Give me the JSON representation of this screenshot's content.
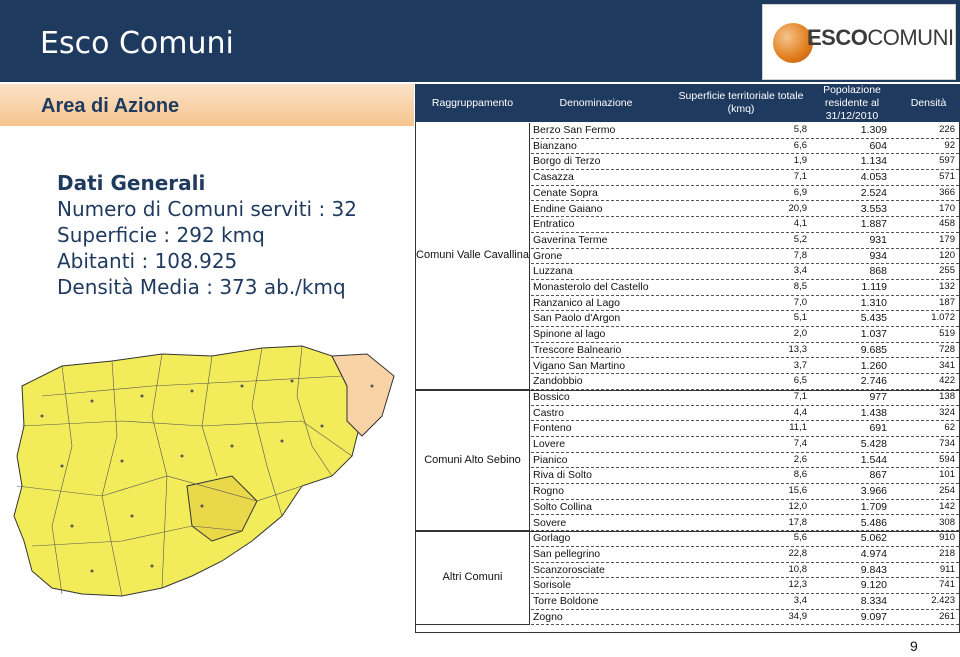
{
  "header": {
    "title": "Esco Comuni"
  },
  "logo": {
    "text_bold": "ESCO",
    "text_thin": "COMUNI"
  },
  "left": {
    "area_title": "Area di Azione",
    "dati_heading": "Dati Generali",
    "dati_lines": [
      "Numero di Comuni serviti : 32",
      "Superficie : 292 kmq",
      "Abitanti : 108.925",
      "Densità Media : 373 ab./kmq"
    ]
  },
  "table": {
    "headers": {
      "raggruppamento": "Raggruppamento",
      "denominazione": "Denominazione",
      "superficie": "Superficie territoriale totale (kmq)",
      "popolazione": "Popolazione residente al 31/12/2010",
      "densita": "Densità"
    },
    "groups": [
      {
        "label": "Comuni Valle Cavallina",
        "rows": [
          [
            "Berzo San Fermo",
            "5,8",
            "1.309",
            "226"
          ],
          [
            "Bianzano",
            "6,6",
            "604",
            "92"
          ],
          [
            "Borgo di Terzo",
            "1,9",
            "1.134",
            "597"
          ],
          [
            "Casazza",
            "7,1",
            "4.053",
            "571"
          ],
          [
            "Cenate Sopra",
            "6,9",
            "2.524",
            "366"
          ],
          [
            "Endine Gaiano",
            "20,9",
            "3.553",
            "170"
          ],
          [
            "Entratico",
            "4,1",
            "1.887",
            "458"
          ],
          [
            "Gaverina Terme",
            "5,2",
            "931",
            "179"
          ],
          [
            "Grone",
            "7,8",
            "934",
            "120"
          ],
          [
            "Luzzana",
            "3,4",
            "868",
            "255"
          ],
          [
            "Monasterolo del Castello",
            "8,5",
            "1.119",
            "132"
          ],
          [
            "Ranzanico al Lago",
            "7,0",
            "1.310",
            "187"
          ],
          [
            "San Paolo d'Argon",
            "5,1",
            "5.435",
            "1.072"
          ],
          [
            "Spinone al lago",
            "2,0",
            "1.037",
            "519"
          ],
          [
            "Trescore Balneario",
            "13,3",
            "9.685",
            "728"
          ],
          [
            "Vigano San Martino",
            "3,7",
            "1.260",
            "341"
          ],
          [
            "Zandobbio",
            "6,5",
            "2.746",
            "422"
          ]
        ]
      },
      {
        "label": "Comuni Alto Sebino",
        "rows": [
          [
            "Bossico",
            "7,1",
            "977",
            "138"
          ],
          [
            "Castro",
            "4,4",
            "1.438",
            "324"
          ],
          [
            "Fonteno",
            "11,1",
            "691",
            "62"
          ],
          [
            "Lovere",
            "7,4",
            "5.428",
            "734"
          ],
          [
            "Pianico",
            "2,6",
            "1.544",
            "594"
          ],
          [
            "Riva di Solto",
            "8,6",
            "867",
            "101"
          ],
          [
            "Rogno",
            "15,6",
            "3.966",
            "254"
          ],
          [
            "Solto Collina",
            "12,0",
            "1.709",
            "142"
          ],
          [
            "Sovere",
            "17,8",
            "5.486",
            "308"
          ]
        ]
      },
      {
        "label": "Altri Comuni",
        "rows": [
          [
            "Gorlago",
            "5,6",
            "5.062",
            "910"
          ],
          [
            "San pellegrino",
            "22,8",
            "4.974",
            "218"
          ],
          [
            "Scanzorosciate",
            "10,8",
            "9.843",
            "911"
          ],
          [
            "Sorisole",
            "12,3",
            "9.120",
            "741"
          ],
          [
            "Torre Boldone",
            "3,4",
            "8.334",
            "2.423"
          ],
          [
            "Zogno",
            "34,9",
            "9.097",
            "261"
          ]
        ]
      }
    ]
  },
  "page_number": "9",
  "colors": {
    "header": "#1f3a5f",
    "accent": "#f6c48f",
    "map_fill": "#f2ec5a",
    "map_highlight": "#f8d3a6"
  }
}
